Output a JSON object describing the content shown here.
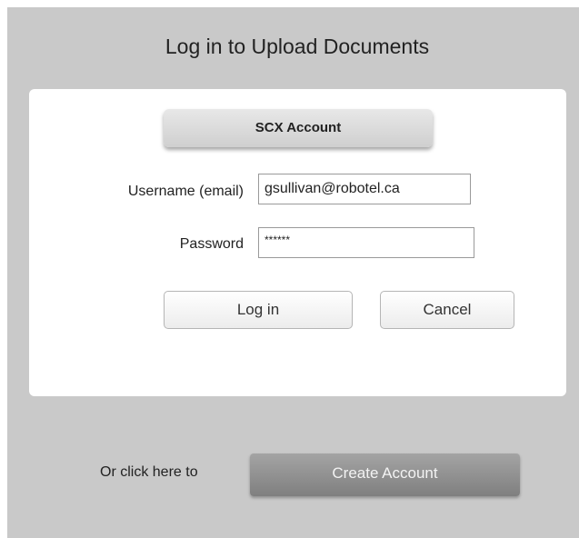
{
  "dialog": {
    "title": "Log in to Upload Documents",
    "account_tab": "SCX Account",
    "username_label": "Username (email)",
    "username_value": "gsullivan@robotel.ca",
    "password_label": "Password",
    "password_value": "******",
    "login_button": "Log in",
    "cancel_button": "Cancel"
  },
  "footer": {
    "prompt": "Or click here to",
    "create_button": "Create Account"
  },
  "colors": {
    "background": "#c9c9c9",
    "card": "#ffffff",
    "create_button": "#8e8e8e"
  }
}
